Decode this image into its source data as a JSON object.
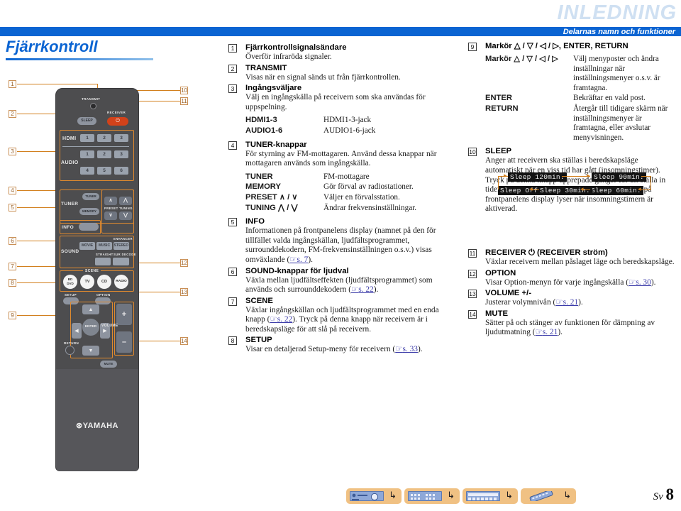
{
  "header": {
    "chapter": "INLEDNING",
    "section": "Delarnas namn och funktioner",
    "title": "Fjärrkontroll",
    "accent_blue": "#0b64d2",
    "chapter_blue": "#cfe0f2"
  },
  "footer": {
    "page_label": "Sv",
    "page_number": "8",
    "badges": [
      "receiver-front-panel-icon",
      "receiver-rear-panel-icon",
      "receiver-display-icon",
      "remote-control-icon"
    ],
    "badge_hook_glyph": "↳",
    "badge_color": "#f0c183"
  },
  "remote": {
    "brand": "YAMAHA",
    "body_color": "#4d4d4f",
    "accent_orange": "#e08a2e",
    "power_color": "#d2421a",
    "labels": {
      "transmit": "TRANSMIT",
      "sleep": "SLEEP",
      "receiver": "RECEIVER",
      "receiver_power_glyph": "⏻",
      "hdmi": "HDMI",
      "audio": "AUDIO",
      "tuner": "TUNER",
      "tuner_btn": "TUNER",
      "memory": "MEMORY",
      "preset": "PRESET",
      "tuning": "TUNING",
      "info": "INFO",
      "sound": "SOUND",
      "movie": "MOVIE",
      "music": "MUSIC",
      "stereo": "STEREO",
      "enhancer": "ENHANCER",
      "straight": "STRAIGHT",
      "sur_decode": "SUR DECODE",
      "scene": "SCENE",
      "scene_bd_dvd_1": "BD",
      "scene_bd_dvd_2": "DVD",
      "scene_tv": "TV",
      "scene_cd": "CD",
      "scene_radio": "RADIO",
      "setup": "SETUP",
      "option": "OPTION",
      "enter": "ENTER",
      "return": "RETURN",
      "volume": "VOLUME",
      "volume_plus": "+",
      "volume_minus": "–",
      "mute": "MUTE"
    },
    "hdmi_buttons": [
      "1",
      "2",
      "3"
    ],
    "audio_buttons_row1": [
      "1",
      "2",
      "3"
    ],
    "audio_buttons_row2": [
      "4",
      "5",
      "6"
    ],
    "callouts_left": [
      "1",
      "2",
      "3",
      "4",
      "5",
      "6",
      "7",
      "8",
      "9"
    ],
    "callouts_right": [
      "10",
      "11",
      "12",
      "13",
      "14"
    ]
  },
  "items_mid": [
    {
      "num": "1",
      "term": "Fjärrkontrollsignalsändare",
      "desc": "Överför infraröda signaler."
    },
    {
      "num": "2",
      "term": "TRANSMIT",
      "desc": "Visas när en signal sänds ut från fjärrkontrollen."
    },
    {
      "num": "3",
      "term": "Ingångsväljare",
      "desc": "Välj en ingångskälla på receivern som ska användas för uppspelning.",
      "table": [
        {
          "k": "HDMI1-3",
          "v": "HDMI1-3-jack"
        },
        {
          "k": "AUDIO1-6",
          "v": "AUDIO1-6-jack"
        }
      ]
    },
    {
      "num": "4",
      "term": "TUNER-knappar",
      "desc": "För styrning av FM-mottagaren. Använd dessa knappar när mottagaren används som ingångskälla.",
      "table": [
        {
          "k": "TUNER",
          "v": "FM-mottagare"
        },
        {
          "k": "MEMORY",
          "v": "Gör förval av radiostationer."
        },
        {
          "k": "PRESET ∧ / ∨",
          "v": "Väljer en förvalsstation."
        },
        {
          "k": "TUNING ⋀ / ⋁",
          "v": "Ändrar frekvensinställningar."
        }
      ]
    },
    {
      "num": "5",
      "term": "INFO",
      "desc_pre": "Informationen på frontpanelens display (namnet på den för tillfället valda ingångskällan, ljudfältsprogrammet, surrounddekodern, FM-frekvensinställningen o.s.v.) visas omväxlande (",
      "ref": "s. 7",
      "desc_post": ")."
    },
    {
      "num": "6",
      "term": "SOUND-knappar för ljudval",
      "desc_pre": "Växla mellan ljudfältseffekten (ljudfältsprogrammet) som används och surrounddekodern (",
      "ref": "s. 22",
      "desc_post": ")."
    },
    {
      "num": "7",
      "term": "SCENE",
      "desc_pre": "Växlar ingångskällan och ljudfältsprogrammet med en enda knapp (",
      "ref": "s. 22",
      "desc_post": "). Tryck på denna knapp när receivern är i beredskapsläge för att slå på receivern."
    },
    {
      "num": "8",
      "term": "SETUP",
      "desc_pre": "Visar en detaljerad Setup-meny för receivern (",
      "ref": "s. 33",
      "desc_post": ")."
    }
  ],
  "items_right": [
    {
      "num": "9",
      "term": "Markör △ / ▽ / ◁ / ▷, ENTER, RETURN",
      "table": [
        {
          "k": "Markör △ / ▽ / ◁ / ▷",
          "v": "Välj menyposter och ändra inställningar när inställningsmenyer o.s.v. är framtagna."
        },
        {
          "k": "ENTER",
          "v": "Bekräftar en vald post."
        },
        {
          "k": "RETURN",
          "v": "Återgår till tidigare skärm när inställningsmenyer är framtagna, eller avslutar menyvisningen."
        }
      ]
    },
    {
      "num": "10",
      "term": "SLEEP",
      "desc": "Anger att receivern ska ställas i beredskapsläge automatiskt när en viss tid har gått (insomningstimer). Tryck på denna knapp upprepade gånger för att ställa in tiden för insomningstimerfunktionen. Indikatorn på frontpanelens display lyser när insomningstimern är aktiverad."
    },
    {
      "num": "11",
      "term": "RECEIVER ⏻ (RECEIVER ström)",
      "desc": "Växlar receivern mellan påslaget läge och beredskapsläge."
    },
    {
      "num": "12",
      "term": "OPTION",
      "desc_pre": "Visar Option-menyn för varje ingångskälla (",
      "ref": "s. 30",
      "desc_post": ")."
    },
    {
      "num": "13",
      "term": "VOLUME +/-",
      "desc_pre": "Justerar volymnivån (",
      "ref": "s. 21",
      "desc_post": ")."
    },
    {
      "num": "14",
      "term": "MUTE",
      "desc_pre": "Sätter på och stänger av funktionen för dämpning av ljudutmatning (",
      "ref": "s. 21",
      "desc_post": ")."
    }
  ],
  "sleep_cycle": {
    "steps": [
      "Sleep 120min.",
      "Sleep 90min.",
      "Sleep 60min.",
      "Sleep 30min.",
      "Sleep Off"
    ],
    "chip_bg": "#131313",
    "arrow_color": "#d2801e"
  }
}
